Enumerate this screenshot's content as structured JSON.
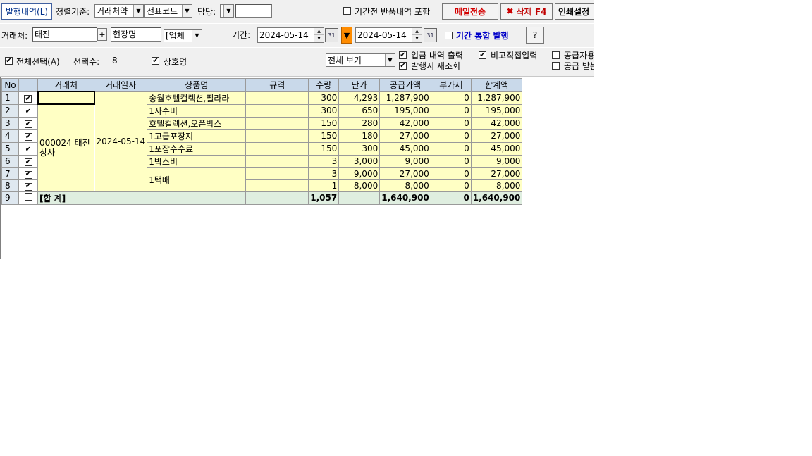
{
  "toolbar": {
    "tab_label": "발행내역(L)",
    "sort_label": "정렬기준:",
    "sort1_value": "거래처약",
    "sort2_value": "전표코드",
    "manager_label": "담당:",
    "manager_value": "",
    "include_returns_label": "기간전 반품내역 포함",
    "include_returns_checked": false,
    "email_button": "메일전송",
    "delete_button": "삭제 F4",
    "print_settings_button": "인쇄설정"
  },
  "filter": {
    "client_label": "거래처:",
    "client_value": "태진",
    "client_search_button": "+",
    "site_value": "현장명",
    "type_value": "[업체",
    "period_label": "기간:",
    "date_from": "2024-05-14",
    "date_to": "2024-05-14",
    "calendar_label": "31",
    "period_merge_label": "기간 통합 발행",
    "period_merge_checked": false,
    "help_button": "?"
  },
  "options": {
    "select_all_label": "전체선택(A)",
    "select_all_checked": true,
    "selected_count_label": "선택수:",
    "selected_count": "8",
    "company_name_label": "상호명",
    "company_name_checked": true,
    "view_value": "전체 보기",
    "deposit_output_label": "입금 내역 출력",
    "deposit_output_checked": true,
    "reload_label": "발행시 재조회",
    "reload_checked": true,
    "remark_direct_label": "비고직접입력",
    "remark_direct_checked": true,
    "supplier_label": "공급자용",
    "supplier_checked": false,
    "receiver_label": "공급 받는",
    "receiver_checked": false
  },
  "grid": {
    "headers": [
      "No",
      "",
      "거래처",
      "거래일자",
      "상품명",
      "규격",
      "수량",
      "단가",
      "공급가액",
      "부가세",
      "합계액"
    ],
    "client": "000024 태진상사",
    "date": "2024-05-14",
    "rows": [
      {
        "no": "1",
        "product": "송월호텔컬렉션,필라라",
        "spec": "",
        "qty": "300",
        "price": "4,293",
        "supply": "1,287,900",
        "vat": "0",
        "total": "1,287,900"
      },
      {
        "no": "2",
        "product": "1자수비",
        "spec": "",
        "qty": "300",
        "price": "650",
        "supply": "195,000",
        "vat": "0",
        "total": "195,000"
      },
      {
        "no": "3",
        "product": "호텔컬렉션,오픈박스",
        "spec": "",
        "qty": "150",
        "price": "280",
        "supply": "42,000",
        "vat": "0",
        "total": "42,000"
      },
      {
        "no": "4",
        "product": "1고급포장지",
        "spec": "",
        "qty": "150",
        "price": "180",
        "supply": "27,000",
        "vat": "0",
        "total": "27,000"
      },
      {
        "no": "5",
        "product": "1포장수수료",
        "spec": "",
        "qty": "150",
        "price": "300",
        "supply": "45,000",
        "vat": "0",
        "total": "45,000"
      },
      {
        "no": "6",
        "product": "1박스비",
        "spec": "",
        "qty": "3",
        "price": "3,000",
        "supply": "9,000",
        "vat": "0",
        "total": "9,000"
      },
      {
        "no": "7",
        "product": "1택배",
        "spec": "",
        "qty": "3",
        "price": "9,000",
        "supply": "27,000",
        "vat": "0",
        "total": "27,000"
      },
      {
        "no": "8",
        "product": "",
        "spec": "",
        "qty": "1",
        "price": "8,000",
        "supply": "8,000",
        "vat": "0",
        "total": "8,000"
      }
    ],
    "total_row": {
      "no": "9",
      "label": "[합 계]",
      "qty": "1,057",
      "supply": "1,640,900",
      "vat": "0",
      "total": "1,640,900"
    }
  }
}
